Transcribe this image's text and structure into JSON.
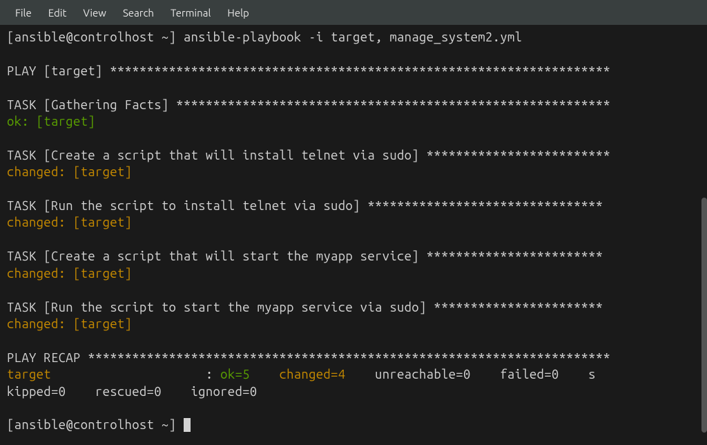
{
  "menuBar": {
    "items": [
      "File",
      "Edit",
      "View",
      "Search",
      "Terminal",
      "Help"
    ]
  },
  "prompt1": "[ansible@controlhost ~]",
  "command": "ansible-playbook -i target, manage_system2.yml",
  "playHeader": "PLAY [target] ********************************************************************",
  "task1Header": "TASK [Gathering Facts] ***********************************************************",
  "task1Status": "ok: [target]",
  "task2Header": "TASK [Create a script that will install telnet via sudo] *************************",
  "task2Status": "changed: [target]",
  "task3Header": "TASK [Run the script to install telnet via sudo] ********************************",
  "task3Status": "changed: [target]",
  "task4Header": "TASK [Create a script that will start the myapp service] ************************",
  "task4Status": "changed: [target]",
  "task5Header": "TASK [Run the script to start the myapp service via sudo] ***********************",
  "task5Status": "changed: [target]",
  "recapHeader": "PLAY RECAP ***********************************************************************",
  "recapTarget": "target",
  "recapColon": "                     : ",
  "recapOk": "ok=5   ",
  "recapChanged": " changed=4   ",
  "recapRest": " unreachable=0    failed=0    s",
  "recapLine2": "kipped=0    rescued=0    ignored=0",
  "prompt2": "[ansible@controlhost ~] "
}
